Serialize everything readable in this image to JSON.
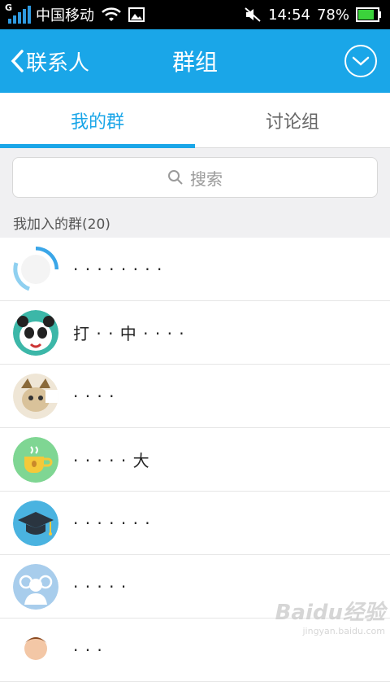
{
  "status_bar": {
    "network_type": "G",
    "carrier": "中国移动",
    "time": "14:54",
    "battery": "78%"
  },
  "header": {
    "back_label": "联系人",
    "title": "群组"
  },
  "tabs": [
    {
      "label": "我的群",
      "active": true
    },
    {
      "label": "讨论组",
      "active": false
    }
  ],
  "search": {
    "placeholder": "搜索"
  },
  "section": {
    "title": "我加入的群(20)"
  },
  "groups": [
    {
      "name": "·  ·  ·  ·  ·  ·  ·  ·",
      "avatar": "blurred-circle-avatar"
    },
    {
      "name": "打  ·  ·  中  ·  ·  ·  ·",
      "avatar": "panda-avatar"
    },
    {
      "name": "·  ·  ·  ·",
      "avatar": "cat-avatar"
    },
    {
      "name": "·  ·  ·  ·  ·  大",
      "avatar": "coffee-cup-avatar"
    },
    {
      "name": "·  ·  ·  ·  ·  ·  ·",
      "avatar": "graduation-cap-avatar"
    },
    {
      "name": "·  ·  ·  ·  ·",
      "avatar": "people-group-avatar"
    },
    {
      "name": "·  ·  ·",
      "avatar": "person-avatar"
    }
  ],
  "watermark": {
    "text": "Baidu经验",
    "sub": "jingyan.baidu.com"
  },
  "colors": {
    "accent": "#1aa6e8",
    "section_bg": "#f0f0f2",
    "battery": "#3bd23b"
  }
}
